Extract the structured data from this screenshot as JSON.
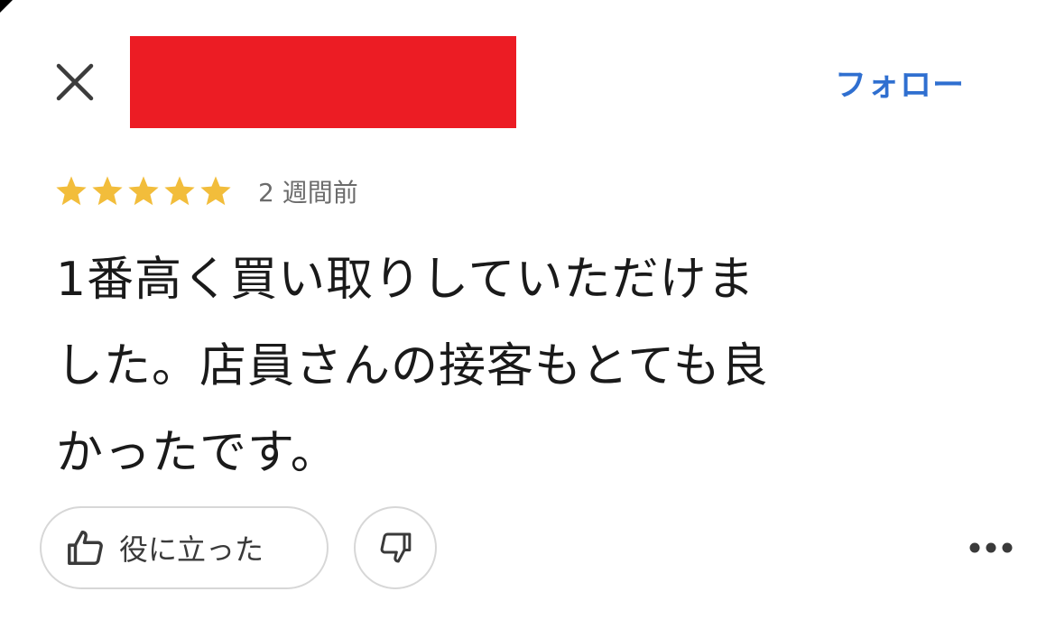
{
  "header": {
    "close_icon": "close-icon",
    "follow_label": "フォロー",
    "accent_color": "#2f6fd0",
    "redaction_color": "#ec1c24"
  },
  "review": {
    "rating": 5,
    "rating_max": 5,
    "star_color": "#f2bd3b",
    "timestamp": "2 週間前",
    "text_line1": "1番高く買い取りしていただけま",
    "text_line2": "した。店員さんの接客もとても良",
    "text_line3": "かったです。"
  },
  "actions": {
    "helpful_label": "役に立った",
    "helpful_icon": "thumbs-up-icon",
    "dislike_icon": "thumbs-down-icon",
    "more_icon": "more-horizontal-icon"
  }
}
